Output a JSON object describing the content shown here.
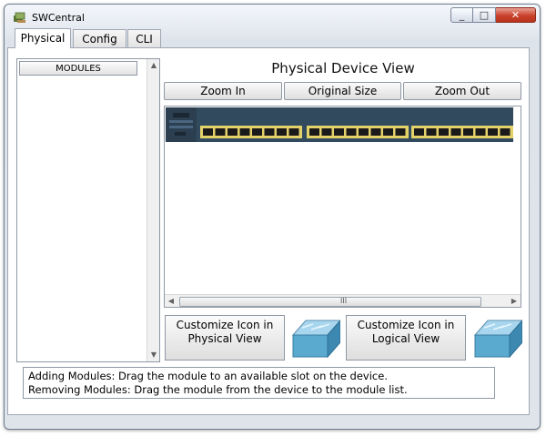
{
  "window": {
    "title": "SWCentral",
    "minimize": "_",
    "maximize": "□",
    "close": "✕"
  },
  "tabs": [
    {
      "label": "Physical",
      "active": true
    },
    {
      "label": "Config",
      "active": false
    },
    {
      "label": "CLI",
      "active": false
    }
  ],
  "modules": {
    "header": "MODULES"
  },
  "device_view": {
    "title": "Physical Device View",
    "zoom_in": "Zoom In",
    "original_size": "Original Size",
    "zoom_out": "Zoom Out",
    "scroll_grip": "III"
  },
  "customize": {
    "physical_label": "Customize Icon in Physical View",
    "logical_label": "Customize Icon in Logical View"
  },
  "info": {
    "line1": "Adding Modules: Drag the module to an available slot on the device.",
    "line2": "Removing Modules: Drag the module from the device to the module list."
  },
  "icons": {
    "app": "network-app-icon",
    "switch": "switch-icon"
  },
  "colors": {
    "switch_body": "#324a5e",
    "switch_port_frame": "#e3d26a",
    "switch_icon_top": "#a8d6ee",
    "switch_icon_side": "#4b9cc4"
  }
}
